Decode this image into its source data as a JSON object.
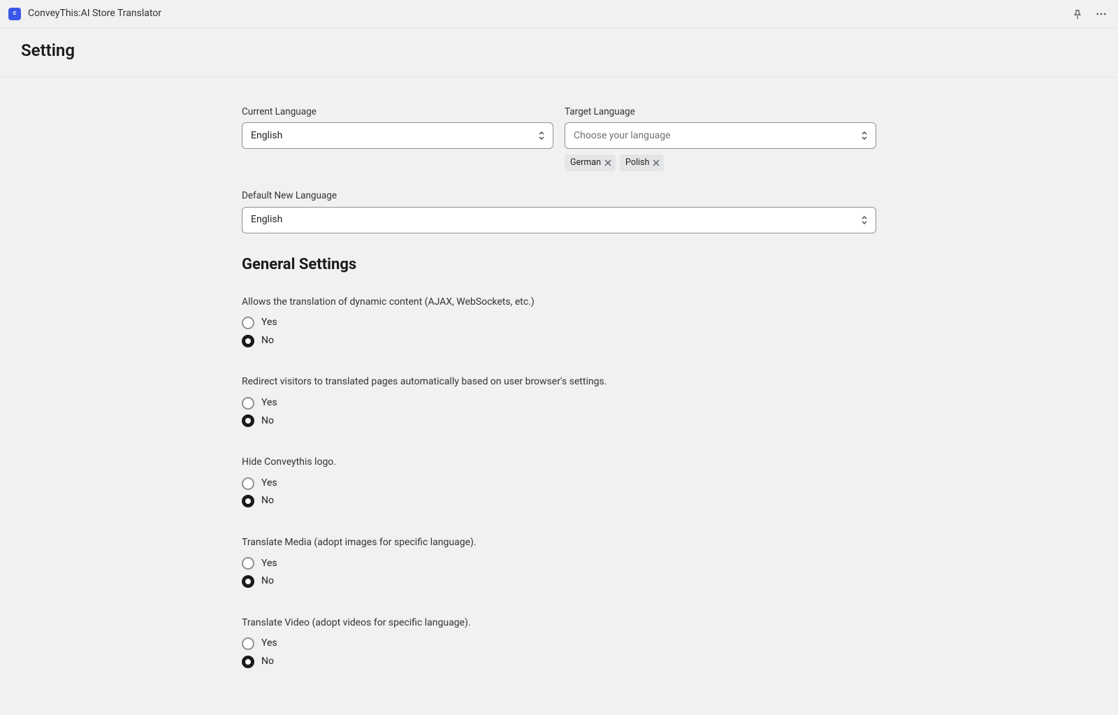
{
  "topbar": {
    "app_title": "ConveyThis:AI Store Translator",
    "app_icon_letter": "c"
  },
  "page": {
    "title": "Setting",
    "general_settings_heading": "General Settings"
  },
  "fields": {
    "current_language": {
      "label": "Current Language",
      "value": "English"
    },
    "target_language": {
      "label": "Target Language",
      "placeholder": "Choose your language",
      "tags": [
        "German",
        "Polish"
      ]
    },
    "default_new_language": {
      "label": "Default New Language",
      "value": "English"
    }
  },
  "radio_options": {
    "yes": "Yes",
    "no": "No"
  },
  "questions": [
    {
      "text": "Allows the translation of dynamic content (AJAX, WebSockets, etc.)",
      "selected": "no"
    },
    {
      "text": "Redirect visitors to translated pages automatically based on user browser's settings.",
      "selected": "no"
    },
    {
      "text": "Hide Conveythis logo.",
      "selected": "no"
    },
    {
      "text": "Translate Media (adopt images for specific language).",
      "selected": "no"
    },
    {
      "text": "Translate Video (adopt videos for specific language).",
      "selected": "no"
    }
  ]
}
